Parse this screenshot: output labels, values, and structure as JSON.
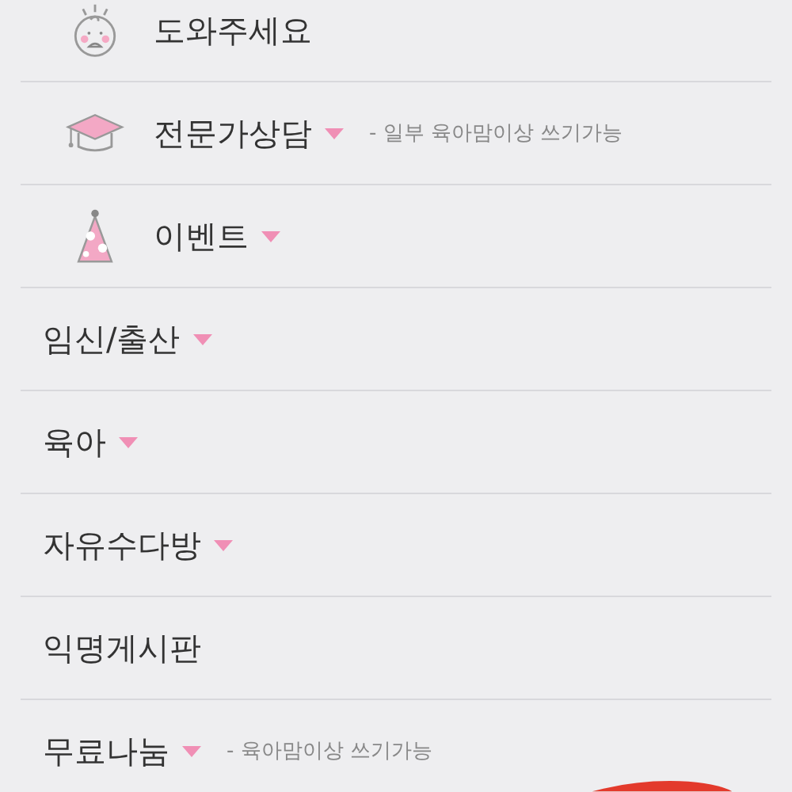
{
  "menu": [
    {
      "kind": "with-icon",
      "label": "도와주세요",
      "dropdown": false
    },
    {
      "kind": "with-icon",
      "label": "전문가상담",
      "dropdown": true,
      "note": "- 일부 육아맘이상 쓰기가능"
    },
    {
      "kind": "with-icon",
      "label": "이벤트",
      "dropdown": true
    },
    {
      "kind": "plain",
      "label": "임신/출산",
      "dropdown": true
    },
    {
      "kind": "plain",
      "label": "육아",
      "dropdown": true
    },
    {
      "kind": "plain",
      "label": "자유수다방",
      "dropdown": true
    },
    {
      "kind": "plain",
      "label": "익명게시판",
      "dropdown": false
    },
    {
      "kind": "plain",
      "label": "무료나눔",
      "dropdown": true,
      "note": "- 육아맘이상 쓰기가능"
    }
  ]
}
